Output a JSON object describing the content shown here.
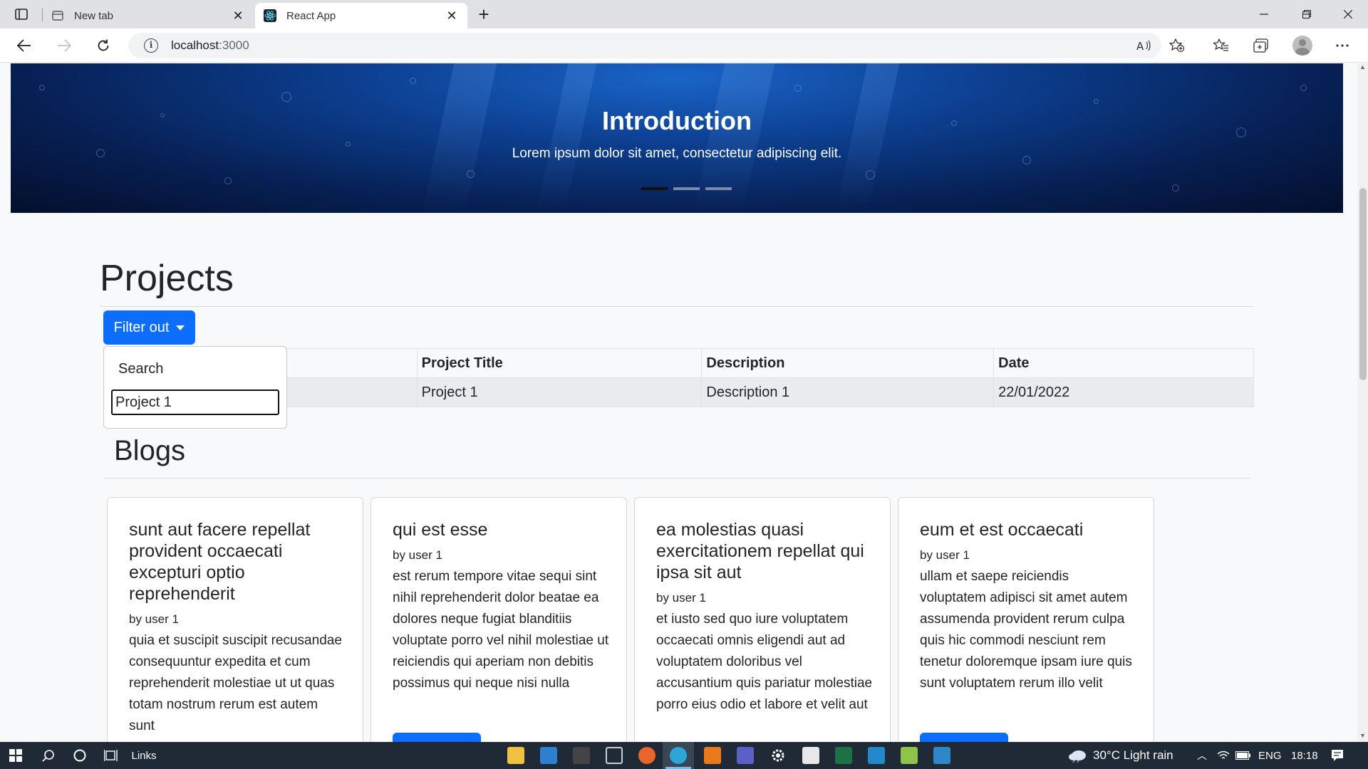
{
  "browser": {
    "tabs": [
      {
        "title": "New tab"
      },
      {
        "title": "React App"
      }
    ],
    "address": {
      "host": "localhost",
      "port": ":3000"
    }
  },
  "carousel": {
    "title": "Introduction",
    "text": "Lorem ipsum dolor sit amet, consectetur adipiscing elit.",
    "slides": 3,
    "active_slide": 1
  },
  "projects": {
    "heading": "Projects",
    "filter_button": "Filter out",
    "dropdown": {
      "label": "Search",
      "input_value": "Project 1"
    },
    "table": {
      "headers": [
        "Project Title",
        "Description",
        "Date"
      ],
      "rows": [
        [
          "Project 1",
          "Description 1",
          "22/01/2022"
        ]
      ]
    }
  },
  "blogs": {
    "heading": "Blogs",
    "cards": [
      {
        "title": "sunt aut facere repellat provident occaecati excepturi optio reprehenderit",
        "author": "by user 1",
        "body": "quia et suscipit suscipit recusandae consequuntur expedita et cum reprehenderit molestiae ut ut quas totam nostrum rerum est autem sunt"
      },
      {
        "title": "qui est esse",
        "author": "by user 1",
        "body": "est rerum tempore vitae sequi sint nihil reprehenderit dolor beatae ea dolores neque fugiat blanditiis voluptate porro vel nihil molestiae ut reiciendis qui aperiam non debitis possimus qui neque nisi nulla"
      },
      {
        "title": "ea molestias quasi exercitationem repellat qui ipsa sit aut",
        "author": "by user 1",
        "body": "et iusto sed quo iure voluptatem occaecati omnis eligendi aut ad voluptatem doloribus vel accusantium quis pariatur molestiae porro eius odio et labore et velit aut"
      },
      {
        "title": "eum et est occaecati",
        "author": "by user 1",
        "body": "ullam et saepe reiciendis voluptatem adipisci sit amet autem assumenda provident rerum culpa quis hic commodi nesciunt rem tenetur doloremque ipsam iure quis sunt voluptatem rerum illo velit"
      }
    ]
  },
  "taskbar": {
    "links_label": "Links",
    "weather": "30°C  Light rain",
    "language": "ENG",
    "time": "18:18"
  },
  "colors": {
    "primary": "#0d6efd",
    "taskbar": "#1f2a36"
  }
}
